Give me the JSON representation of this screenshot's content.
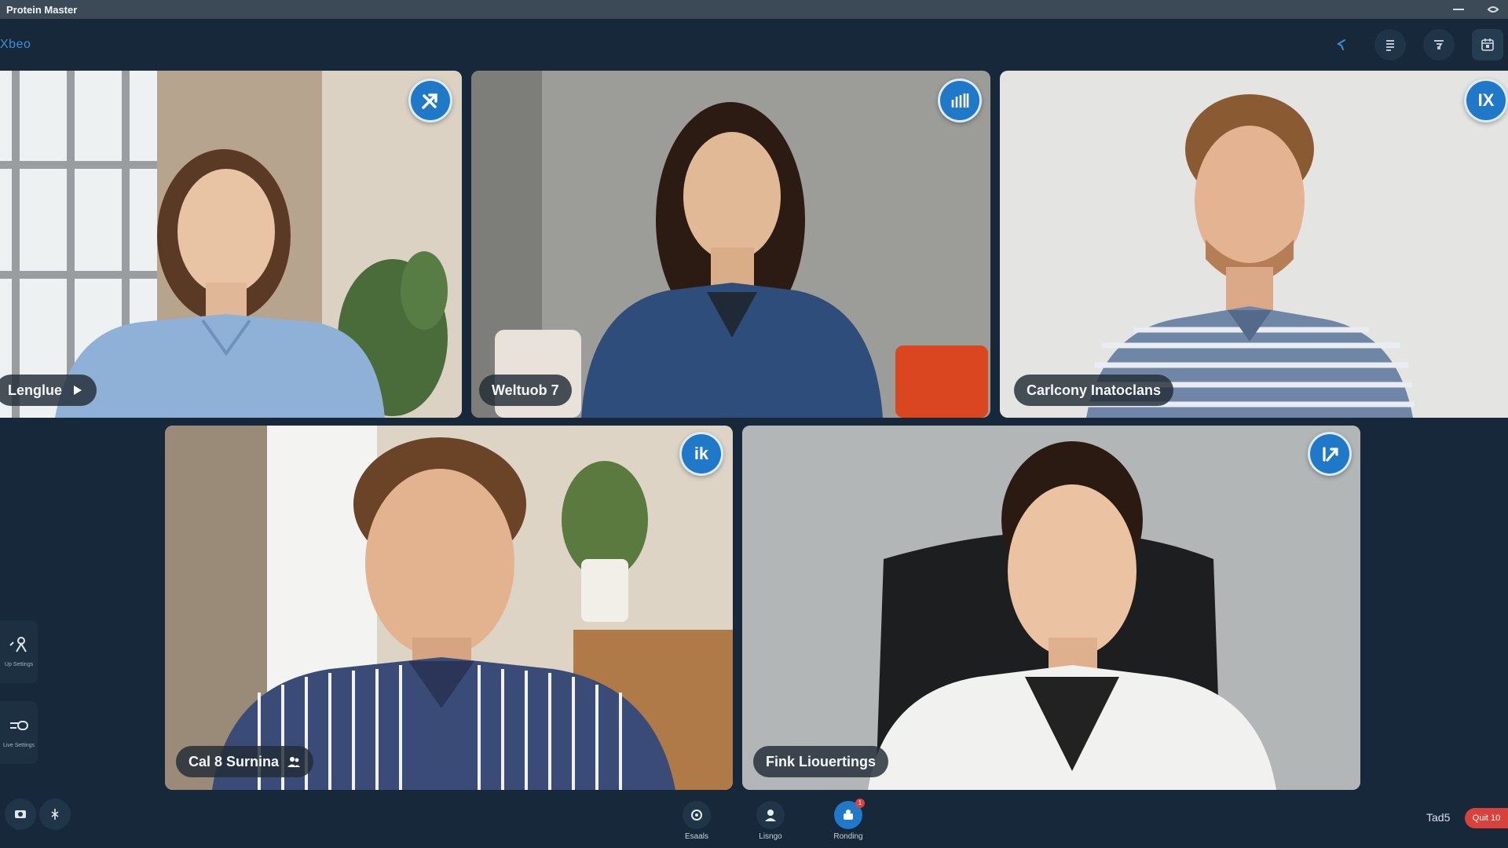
{
  "window": {
    "title": "Protein Master",
    "controls": [
      "minimize-icon",
      "close-icon"
    ]
  },
  "toolbar": {
    "brand": "Xbeo",
    "tools": [
      "pointer-icon",
      "list-icon",
      "filter-icon",
      "calendar-icon"
    ]
  },
  "participants": [
    {
      "name": "Lenglue",
      "badge_icon": "pen-icon",
      "nameplate_icon": "play-icon",
      "bg": "#cbb9a2",
      "shirt": "#8fb1d8",
      "hair": "#5a3a24",
      "skin": "#e8c3a4"
    },
    {
      "name": "Weltuob 7",
      "badge_icon": "signal-bars-icon",
      "nameplate_icon": "",
      "bg": "#9a9a96",
      "shirt": "#2e4d7a",
      "hair": "#2b1b12",
      "skin": "#e2b996"
    },
    {
      "name": "Carlcony Inatoclans",
      "badge_icon": "ix-icon",
      "badge_text": "IX",
      "nameplate_icon": "",
      "bg": "#e4e4e2",
      "shirt": "#6f86a6",
      "hair": "#8a5a32",
      "skin": "#e4b392"
    },
    {
      "name": "Cal 8 Surnina",
      "badge_icon": "ik-icon",
      "badge_text": "ik",
      "nameplate_icon": "people-icon",
      "bg": "#d9cfbf",
      "shirt": "#3b4b78",
      "hair": "#6b4327",
      "skin": "#e2b38e"
    },
    {
      "name": "Fink Liouertings",
      "badge_icon": "pen-icon",
      "badge_text": "",
      "nameplate_icon": "",
      "bg": "#a9acad",
      "shirt": "#f1f1ef",
      "hair": "#2a1a12",
      "skin": "#ecc3a2"
    }
  ],
  "sidebar": {
    "items": [
      {
        "icon": "person-pin-icon",
        "label": "Up\nSettings"
      },
      {
        "icon": "toggle-icon",
        "label": "Live\nSettings"
      }
    ],
    "mini": [
      "camera-icon",
      "mic-icon"
    ]
  },
  "bottom_bar": {
    "actions": [
      {
        "icon": "share-icon",
        "label": "Esaals",
        "active": false
      },
      {
        "icon": "user-icon",
        "label": "Lisngo",
        "active": false
      },
      {
        "icon": "record-icon",
        "label": "Ronding",
        "active": true,
        "badge": "1"
      }
    ],
    "time": "Tad5",
    "end_label": "Quit 10"
  }
}
